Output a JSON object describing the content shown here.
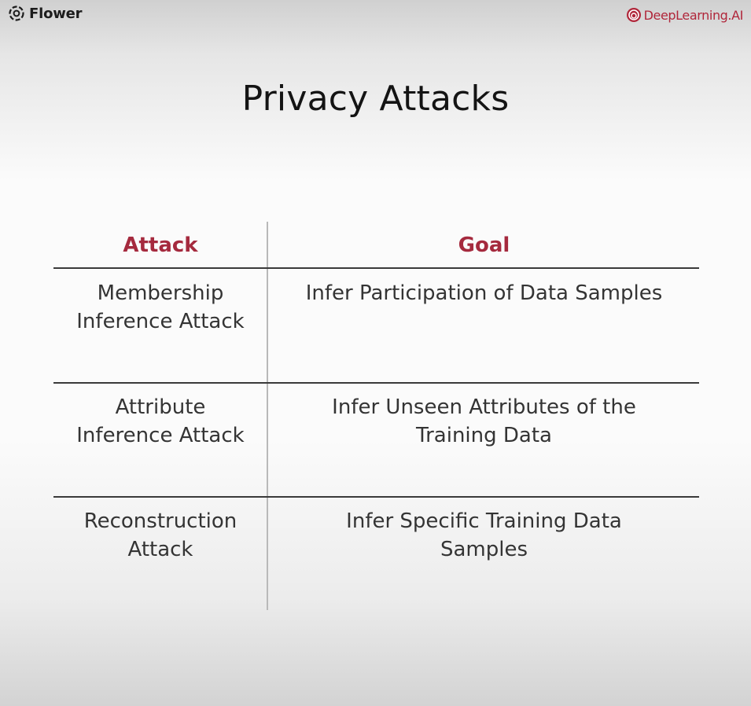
{
  "brands": {
    "left_name": "Flower",
    "left_icon": "flower-logo-icon",
    "right_name": "DeepLearning.AI",
    "right_icon": "deeplearning-ai-logo-icon",
    "accent_color": "#a52a3e"
  },
  "slide": {
    "title": "Privacy Attacks"
  },
  "table": {
    "headers": [
      "Attack",
      "Goal"
    ],
    "rows": [
      {
        "attack_lines": [
          "Membership",
          "Inference Attack"
        ],
        "goal_lines": [
          "Infer Participation of Data Samples"
        ]
      },
      {
        "attack_lines": [
          "Attribute",
          "Inference Attack"
        ],
        "goal_lines": [
          "Infer Unseen Attributes of the",
          "Training Data"
        ]
      },
      {
        "attack_lines": [
          "Reconstruction",
          "Attack"
        ],
        "goal_lines": [
          "Infer Specific Training Data",
          "Samples"
        ]
      }
    ]
  }
}
